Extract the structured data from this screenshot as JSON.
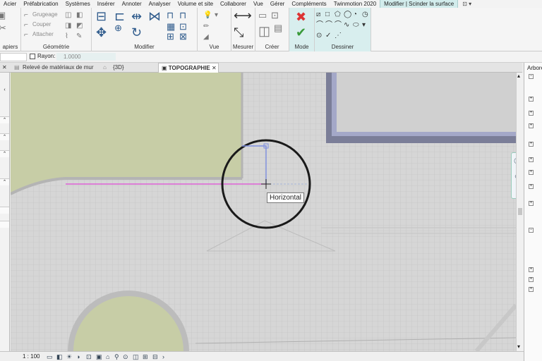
{
  "ribbon_tabs": [
    "Acier",
    "Préfabrication",
    "Systèmes",
    "Insérer",
    "Annoter",
    "Analyser",
    "Volume et site",
    "Collaborer",
    "Vue",
    "Gérer",
    "Compléments",
    "Twinmotion 2020",
    "Modifier | Scinder la surface"
  ],
  "ribbon_tab_extra": "⊡ ▾",
  "panels": {
    "presse_papiers": "apiers",
    "geometrie": "Géométrie",
    "geometrie_items": [
      "Grugeage",
      "Couper",
      "Attacher"
    ],
    "modifier": "Modifier",
    "vue": "Vue",
    "mesurer": "Mesurer",
    "creer": "Créer",
    "mode": "Mode",
    "dessiner": "Dessiner"
  },
  "options_bar": {
    "rayon_label": "Rayon:",
    "rayon_value": "1.0000"
  },
  "view_tabs": {
    "tab1": "Relevé de matériaux de mur",
    "tab2": "{3D}",
    "tab3": "TOPOGRAPHIE"
  },
  "canvas": {
    "tooltip": "Horizontal"
  },
  "browser": {
    "title": "Arbore"
  },
  "status": {
    "scale": "1 : 100"
  },
  "colors": {
    "grass": "#c7cda6",
    "grid_bg": "#d6d6d6",
    "slab": "#d0d0d0",
    "slab_border": "#7b7e98",
    "sketch_line": "#e04ad6",
    "context_tab": "#d2ecec"
  }
}
